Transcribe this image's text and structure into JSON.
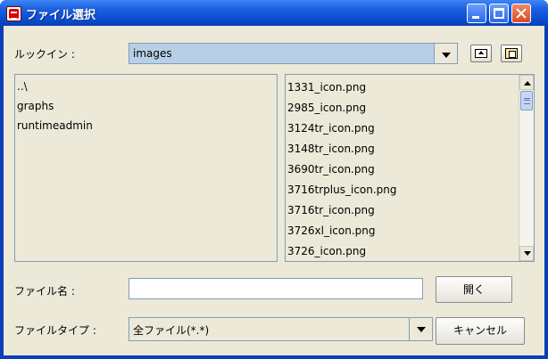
{
  "window": {
    "title": "ファイル選択",
    "title_icon": "java-app-icon",
    "controls": [
      "minimize",
      "maximize",
      "close"
    ]
  },
  "toolbar": {
    "look_in_label": "ルックイン :",
    "look_in_value": "images",
    "up_folder_icon": "up-one-level-icon",
    "home_icon": "home-folder-icon"
  },
  "folders": {
    "items": [
      "..\\",
      "graphs",
      "runtimeadmin"
    ]
  },
  "files": {
    "items": [
      "1331_icon.png",
      "2985_icon.png",
      "3124tr_icon.png",
      "3148tr_icon.png",
      "3690tr_icon.png",
      "3716trplus_icon.png",
      "3716tr_icon.png",
      "3726xl_icon.png",
      "3726_icon.png"
    ]
  },
  "filename": {
    "label": "ファイル名 :",
    "value": "",
    "open_button": "開く"
  },
  "filetype": {
    "label": "ファイルタイプ :",
    "value": "全ファイル(*.*)",
    "cancel_button": "キャンセル"
  },
  "colors": {
    "title_bar": "#0a4fd6",
    "client_bg": "#ece9d8",
    "combo_bg": "#b8cfe5",
    "border": "#7f9db9"
  }
}
